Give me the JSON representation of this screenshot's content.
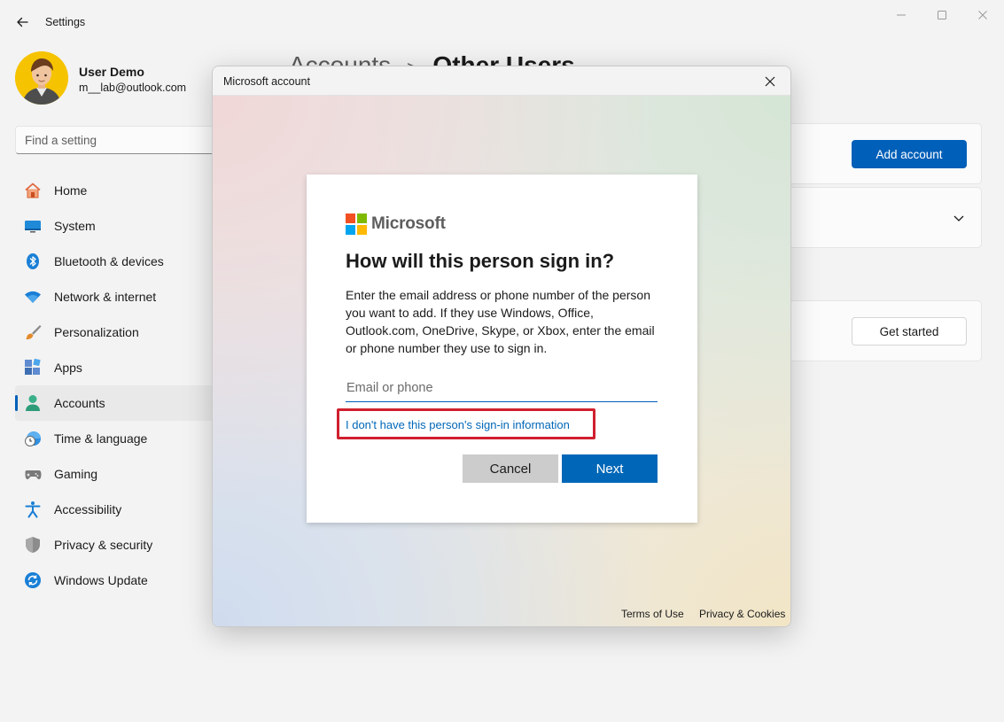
{
  "window": {
    "title": "Settings"
  },
  "profile": {
    "name": "User Demo",
    "email": "m__lab@outlook.com"
  },
  "search": {
    "placeholder": "Find a setting"
  },
  "nav": [
    {
      "label": "Home",
      "icon": "home-icon"
    },
    {
      "label": "System",
      "icon": "system-icon"
    },
    {
      "label": "Bluetooth & devices",
      "icon": "bluetooth-icon"
    },
    {
      "label": "Network & internet",
      "icon": "wifi-icon"
    },
    {
      "label": "Personalization",
      "icon": "brush-icon"
    },
    {
      "label": "Apps",
      "icon": "apps-icon"
    },
    {
      "label": "Accounts",
      "icon": "person-icon",
      "active": true
    },
    {
      "label": "Time & language",
      "icon": "clock-globe-icon"
    },
    {
      "label": "Gaming",
      "icon": "gamepad-icon"
    },
    {
      "label": "Accessibility",
      "icon": "accessibility-icon"
    },
    {
      "label": "Privacy & security",
      "icon": "shield-icon"
    },
    {
      "label": "Windows Update",
      "icon": "update-icon"
    }
  ],
  "page": {
    "breadcrumb_parent": "Accounts",
    "breadcrumb_separator": ">",
    "breadcrumb_current": "Other Users",
    "add_account_label": "Add account",
    "get_started_label": "Get started"
  },
  "dialog": {
    "title": "Microsoft account",
    "brand": "Microsoft",
    "heading": "How will this person sign in?",
    "description": "Enter the email address or phone number of the person you want to add. If they use Windows, Office, Outlook.com, OneDrive, Skype, or Xbox, enter the email or phone number they use to sign in.",
    "input_placeholder": "Email or phone",
    "input_value": "",
    "no_info_link": "I don't have this person's sign-in information",
    "cancel_label": "Cancel",
    "next_label": "Next",
    "terms_label": "Terms of Use",
    "privacy_label": "Privacy & Cookies"
  },
  "colors": {
    "accent": "#005fb8",
    "ms_blue": "#0067b8",
    "highlight_box": "#d0202e",
    "ms_logo": [
      "#f25022",
      "#7fba00",
      "#00a4ef",
      "#ffb900"
    ]
  }
}
